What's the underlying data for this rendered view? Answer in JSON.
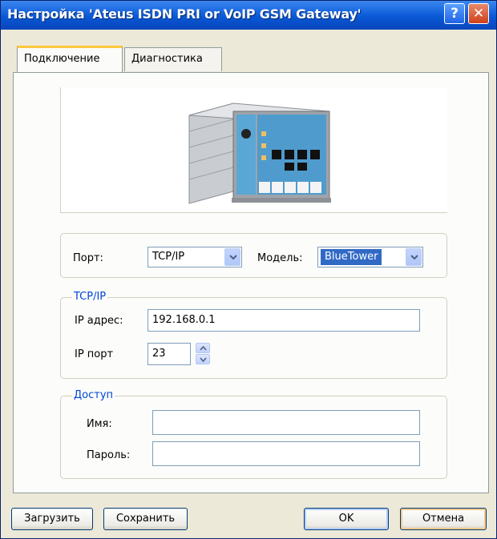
{
  "window": {
    "title": "Настройка 'Ateus ISDN PRI or VoIP GSM Gateway'",
    "help_glyph": "?",
    "close_glyph": "✕"
  },
  "tabs": [
    {
      "label": "Подключение",
      "active": true
    },
    {
      "label": "Диагностика",
      "active": false
    }
  ],
  "port_row": {
    "port_label": "Порт:",
    "port_value": "TCP/IP",
    "model_label": "Модель:",
    "model_value": "BlueTower"
  },
  "tcpip": {
    "group_label": "TCP/IP",
    "ip_label": "IP адрес:",
    "ip_value": "192.168.0.1",
    "port_label": "IP порт",
    "port_value": "23"
  },
  "access": {
    "group_label": "Доступ",
    "name_label": "Имя:",
    "name_value": "",
    "password_label": "Пароль:",
    "password_value": ""
  },
  "buttons": {
    "load": "Загрузить",
    "save": "Сохранить",
    "ok": "OK",
    "cancel": "Отмена"
  },
  "colors": {
    "titlebar": "#0a58d6",
    "group_label": "#0046d5",
    "active_tab_accent": "#ffc73c"
  },
  "icons": {
    "help": "help-icon",
    "close": "close-icon",
    "dropdown": "chevron-down-icon",
    "spin_up": "chevron-up-icon",
    "spin_down": "chevron-down-icon",
    "device": "gateway-device-image"
  }
}
